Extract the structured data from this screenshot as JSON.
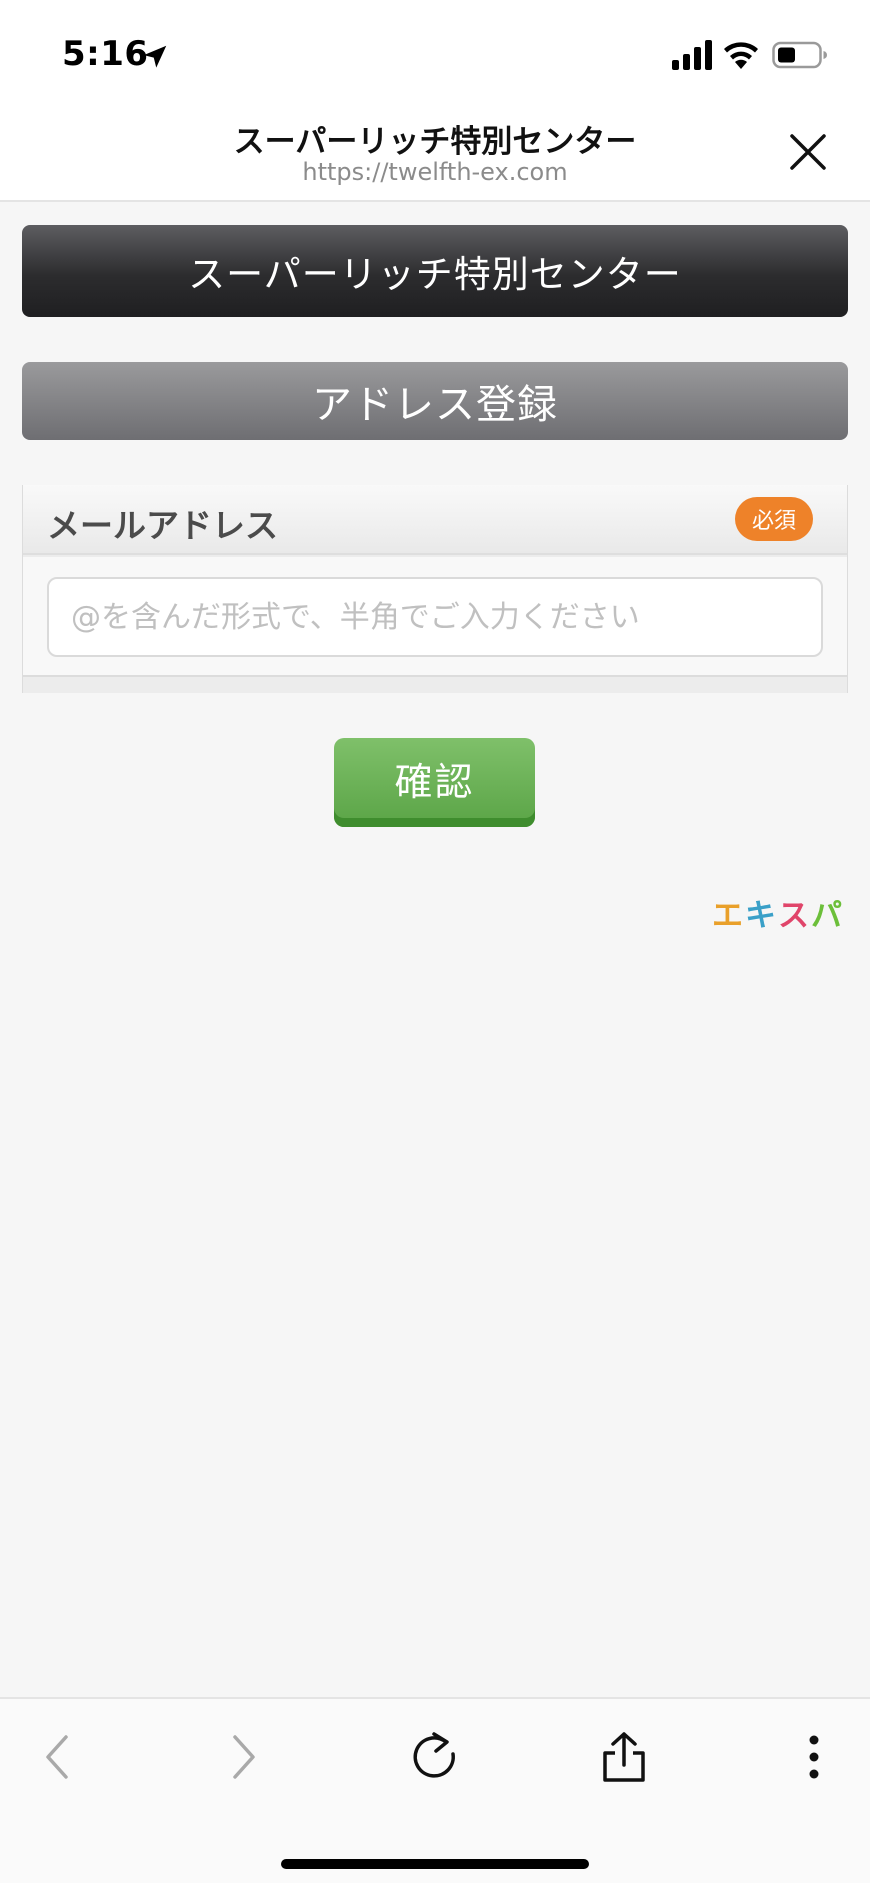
{
  "status_bar": {
    "time": "5:16"
  },
  "browser": {
    "title": "スーパーリッチ特別センター",
    "url": "https://twelfth-ex.com"
  },
  "page": {
    "banner": "スーパーリッチ特別センター",
    "section_title": "アドレス登録",
    "form": {
      "email_label": "メールアドレス",
      "required_badge": "必須",
      "email_value": "",
      "email_placeholder": "@を含んだ形式で、半角でご入力ください"
    },
    "confirm_button": "確認",
    "brand_logo": {
      "chars": [
        "エ",
        "キ",
        "ス",
        "パ"
      ],
      "colors": [
        "#e9a02a",
        "#3aa0c8",
        "#e0456a",
        "#6cbf3a"
      ]
    }
  },
  "toolbar": {
    "items": [
      "back-icon",
      "forward-icon",
      "reload-icon",
      "share-icon",
      "more-icon"
    ]
  },
  "colors": {
    "banner_dark": "#2c2c2e",
    "section_gray": "#808084",
    "required_orange": "#ee8229",
    "confirm_green": "#5aa446"
  }
}
